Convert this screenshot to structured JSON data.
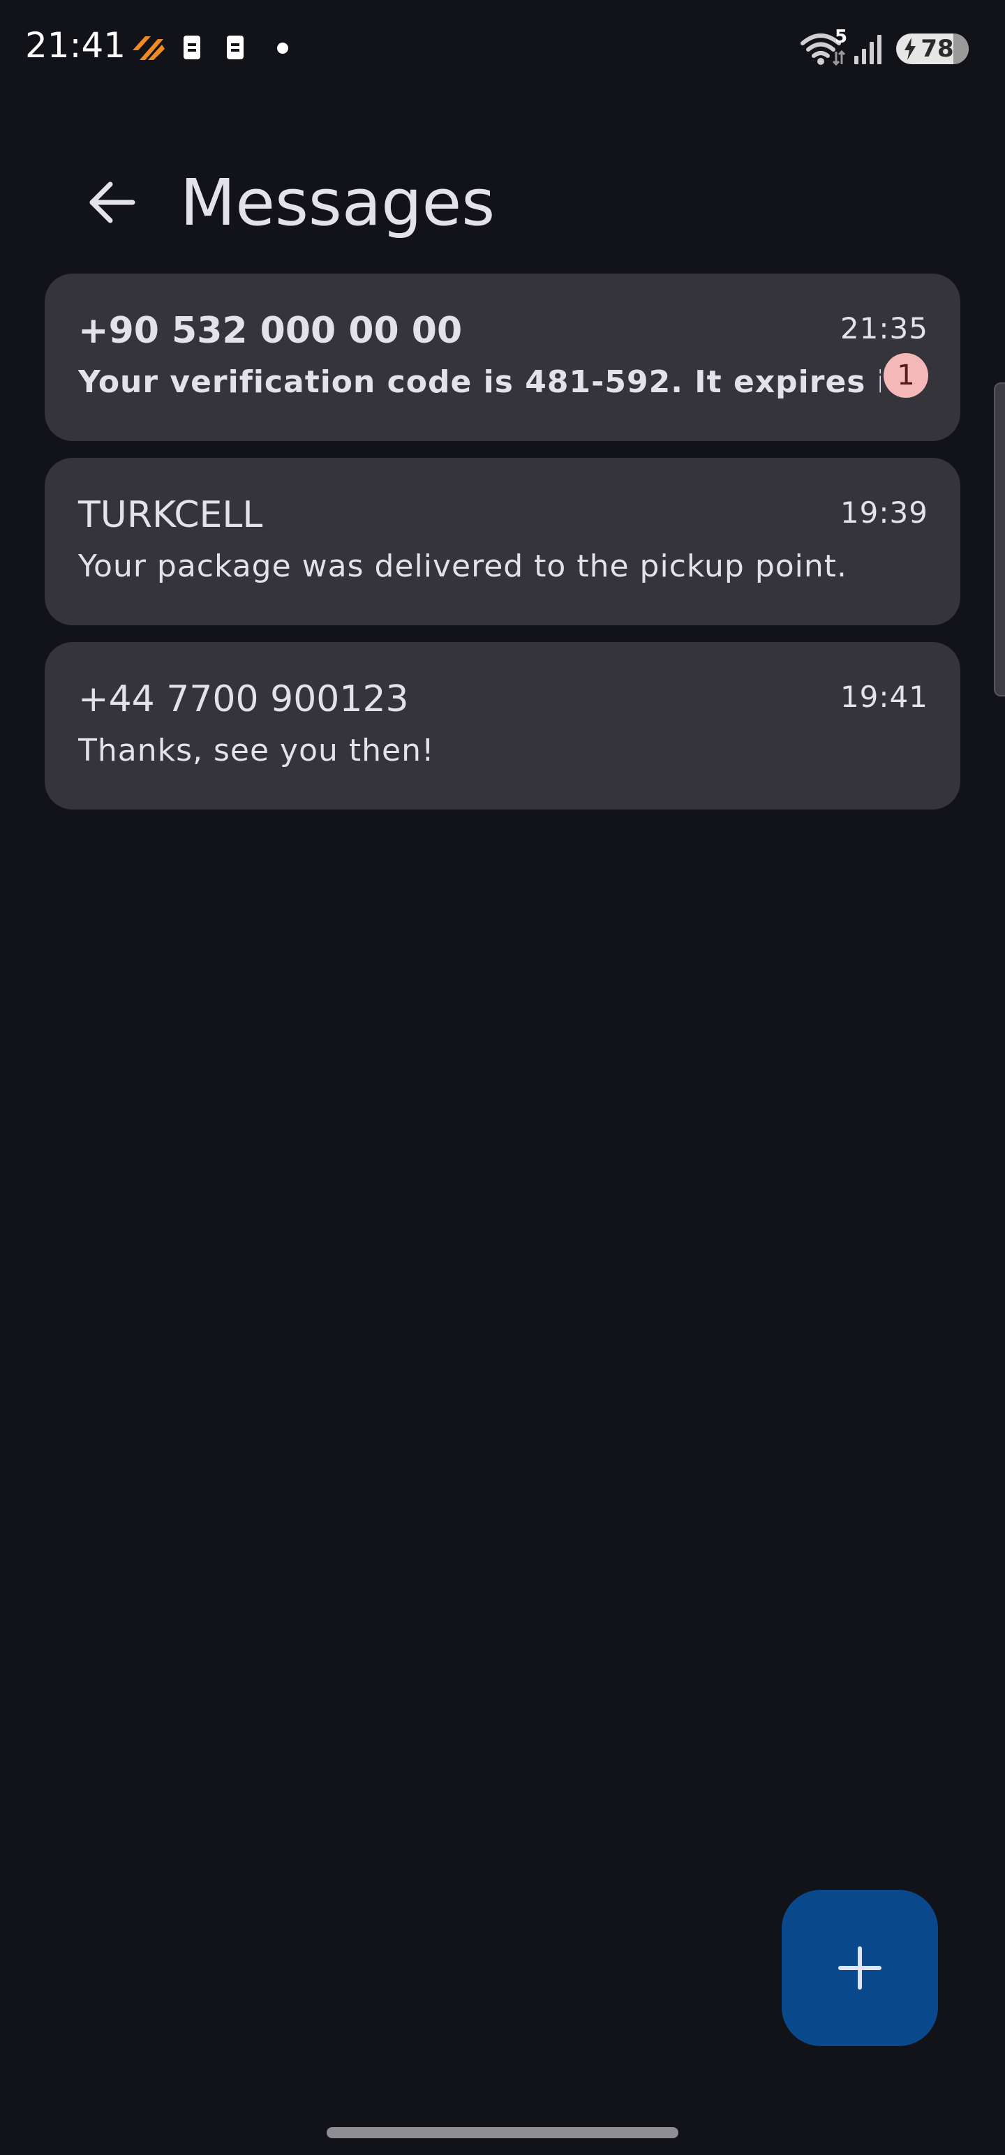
{
  "status_bar": {
    "time": "21:41",
    "wifi_badge": "5",
    "battery_level": "78",
    "icons": [
      "app-notification-icon",
      "sim-icon",
      "sim-icon",
      "dot-icon",
      "wifi-icon",
      "cellular-signal-icon",
      "battery-charging-icon"
    ]
  },
  "app_bar": {
    "title": "Messages",
    "back_icon": "arrow-back-icon"
  },
  "conversations": [
    {
      "sender": "+90 532 000 00 00",
      "snippet": "Your verification code is 481-592. It expires in",
      "time": "21:35",
      "unread_count": "1",
      "unread": true
    },
    {
      "sender": "TURKCELL",
      "snippet": "Your package was delivered to the pickup point.",
      "time": "19:39",
      "unread": false
    },
    {
      "sender": "+44 7700 900123",
      "snippet": "Thanks, see you then!",
      "time": "19:41",
      "unread": false
    }
  ],
  "fab": {
    "icon": "plus-icon"
  },
  "colors": {
    "background": "#121318",
    "card": "#34343a",
    "fab": "#0a4a8c",
    "badge": "#f5b8b8",
    "notification_accent": "#f08a24"
  }
}
